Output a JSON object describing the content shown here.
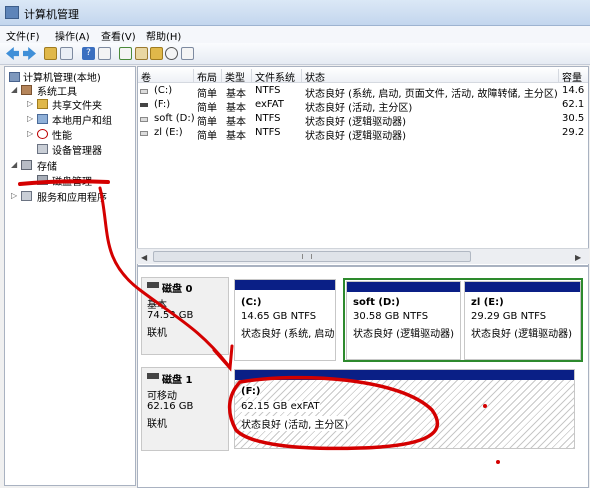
{
  "window": {
    "title": "计算机管理"
  },
  "menu": [
    "文件(F)",
    "操作(A)",
    "查看(V)",
    "帮助(H)"
  ],
  "toolbar": [
    "back-icon",
    "forward-icon",
    "up-icon",
    "show-hide-tree-icon",
    "help-icon",
    "properties-icon",
    "refresh-icon",
    "export-icon",
    "open-icon",
    "search-icon",
    "properties-alt-icon"
  ],
  "tree": {
    "root": "计算机管理(本地)",
    "system_tools": "系统工具",
    "shared_folders": "共享文件夹",
    "local_users": "本地用户和组",
    "performance": "性能",
    "device_manager": "设备管理器",
    "storage": "存储",
    "disk_management": "磁盘管理",
    "services": "服务和应用程序"
  },
  "columns": [
    "卷",
    "布局",
    "类型",
    "文件系统",
    "状态",
    "容量"
  ],
  "volumes": [
    {
      "name": "(C:)",
      "layout": "简单",
      "type": "基本",
      "fs": "NTFS",
      "status": "状态良好 (系统, 启动, 页面文件, 活动, 故障转储, 主分区)",
      "capacity": "14.6"
    },
    {
      "name": "(F:)",
      "layout": "简单",
      "type": "基本",
      "fs": "exFAT",
      "status": "状态良好 (活动, 主分区)",
      "capacity": "62.1"
    },
    {
      "name": "soft (D:)",
      "layout": "简单",
      "type": "基本",
      "fs": "NTFS",
      "status": "状态良好 (逻辑驱动器)",
      "capacity": "30.5"
    },
    {
      "name": "zl (E:)",
      "layout": "简单",
      "type": "基本",
      "fs": "NTFS",
      "status": "状态良好 (逻辑驱动器)",
      "capacity": "29.2"
    }
  ],
  "disk0": {
    "name": "磁盘 0",
    "type": "基本",
    "size": "74.53 GB",
    "state": "联机",
    "c": {
      "label": "(C:)",
      "size": "14.65 GB NTFS",
      "status": "状态良好 (系统, 启动,"
    },
    "d": {
      "label": "soft (D:)",
      "size": "30.58 GB NTFS",
      "status": "状态良好 (逻辑驱动器)"
    },
    "e": {
      "label": "zl (E:)",
      "size": "29.29 GB NTFS",
      "status": "状态良好 (逻辑驱动器)"
    }
  },
  "disk1": {
    "name": "磁盘 1",
    "type": "可移动",
    "size": "62.16 GB",
    "state": "联机",
    "f": {
      "label": "(F:)",
      "size": "62.15 GB exFAT",
      "status": "状态良好 (活动, 主分区)"
    }
  },
  "colors": {
    "volume_bar": "#0a1f86",
    "selection": "#2d8a2d",
    "annotation": "#d40000"
  }
}
